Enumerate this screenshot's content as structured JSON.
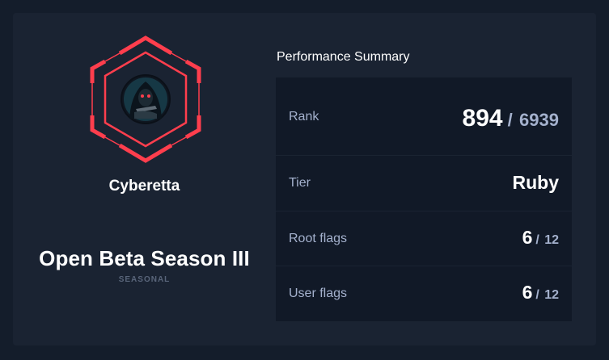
{
  "profile": {
    "username": "Cyberetta",
    "avatar_icon": "hooded-hacker-avatar",
    "badge_icon": "ruby-hexagon-badge-icon"
  },
  "season": {
    "name": "Open Beta Season III",
    "type": "SEASONAL"
  },
  "summary": {
    "title": "Performance Summary",
    "rank": {
      "label": "Rank",
      "value": "894",
      "separator": "/",
      "total": "6939"
    },
    "tier": {
      "label": "Tier",
      "value": "Ruby"
    },
    "root_flags": {
      "label": "Root flags",
      "value": "6",
      "separator": "/",
      "total": "12"
    },
    "user_flags": {
      "label": "User flags",
      "value": "6",
      "separator": "/",
      "total": "12"
    }
  },
  "colors": {
    "background": "#141d2b",
    "card": "#1a2332",
    "rows": "#111927",
    "ruby": "#ff3e4d",
    "muted_text": "#a4b1cd"
  }
}
